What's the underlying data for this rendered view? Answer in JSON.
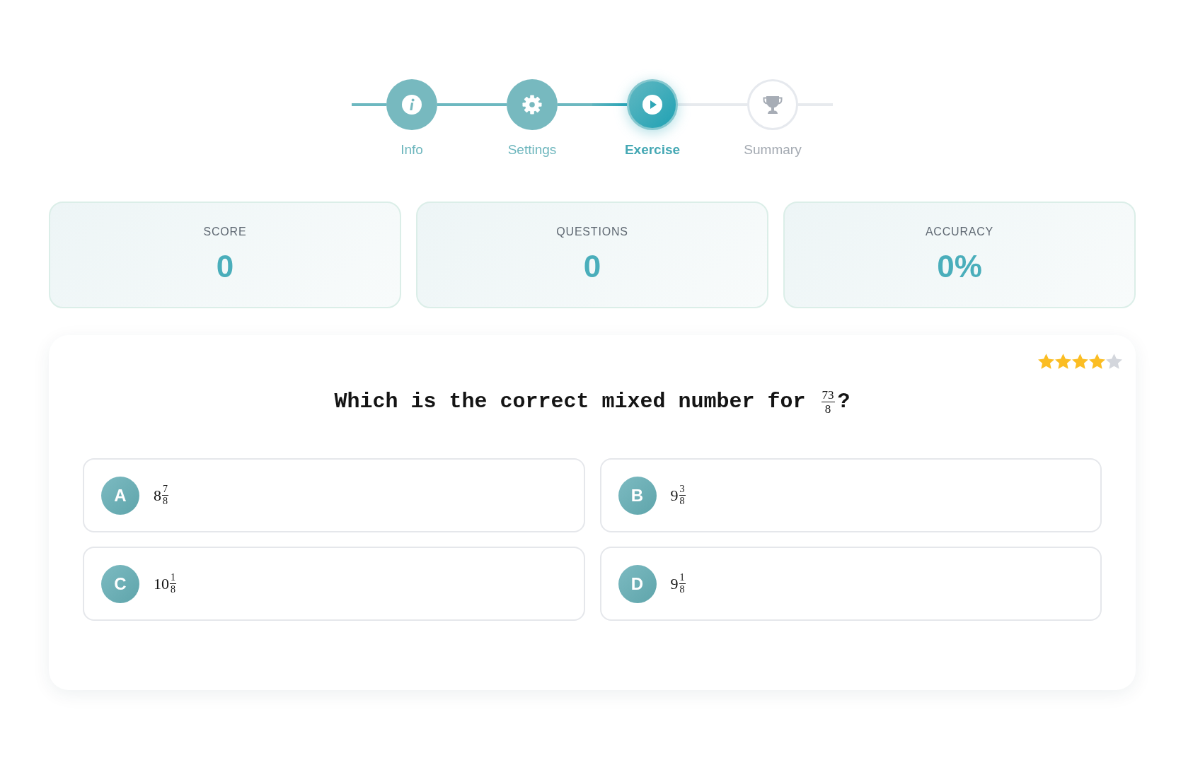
{
  "stepper": {
    "steps": [
      {
        "label": "Info",
        "completed": true,
        "selected": false
      },
      {
        "label": "Settings",
        "completed": true,
        "selected": false
      },
      {
        "label": "Exercise",
        "completed": false,
        "selected": true
      },
      {
        "label": "Summary",
        "completed": false,
        "selected": false
      }
    ]
  },
  "stats": [
    {
      "label": "SCORE",
      "value": "0"
    },
    {
      "label": "QUESTIONS",
      "value": "0"
    },
    {
      "label": "ACCURACY",
      "value": "0%"
    }
  ],
  "exercise": {
    "difficulty": {
      "stars": 4
    },
    "question": {
      "text": "Which is the correct mixed number for",
      "fraction": {
        "numerator": "73",
        "denominator": "8"
      },
      "end": "?"
    },
    "options": [
      {
        "letter": "A",
        "whole": "8",
        "numerator": "7",
        "denominator": "8",
        "selected": false
      },
      {
        "letter": "B",
        "whole": "9",
        "numerator": "3",
        "denominator": "8",
        "selected": false
      },
      {
        "letter": "C",
        "whole": "10",
        "numerator": "1",
        "denominator": "8",
        "selected": false
      },
      {
        "letter": "D",
        "whole": "9",
        "numerator": "1",
        "denominator": "8",
        "selected": false
      }
    ]
  }
}
